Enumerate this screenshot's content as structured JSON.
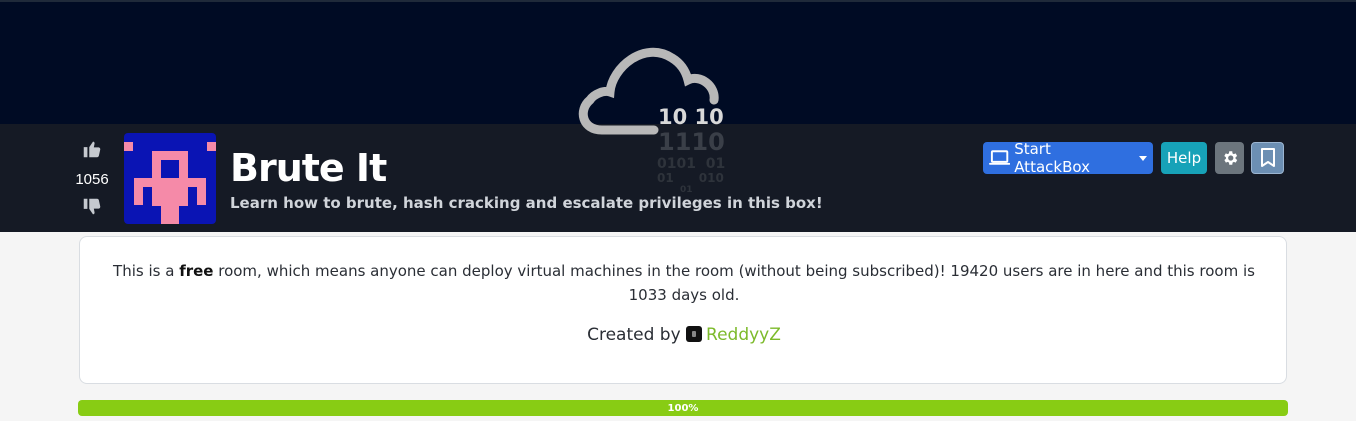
{
  "room": {
    "title": "Brute It",
    "subtitle": "Learn how to brute, hash cracking and escalate privileges in this box!",
    "votes": "1056"
  },
  "actions": {
    "attackbox_label": "Start AttackBox",
    "help_label": "Help"
  },
  "info": {
    "prefix": "This is a ",
    "free_word": "free",
    "suffix": " room, which means anyone can deploy virtual machines in the room (without being subscribed)! 19420 users are in here and this room is 1033 days old.",
    "created_by_label": "Created by ",
    "creator_name": "ReddyyZ"
  },
  "progress": {
    "value": 100,
    "label": "100%"
  },
  "logo": {
    "digits_line1": "10 10",
    "digits_line2": "1110",
    "digits_line3": "0101  01",
    "digits_line4": "01      010",
    "digits_line5": "01"
  },
  "colors": {
    "banner": "#000b24",
    "header": "#151a25",
    "attackbox": "#2f6fe0",
    "help": "#17a2b8",
    "progress": "#88cc14",
    "creator_link": "#7cba2a"
  },
  "icons": {
    "upvote": "thumbs-up-icon",
    "downvote": "thumbs-down-icon",
    "laptop": "laptop-icon",
    "settings": "gear-icon",
    "bookmark": "bookmark-icon"
  }
}
